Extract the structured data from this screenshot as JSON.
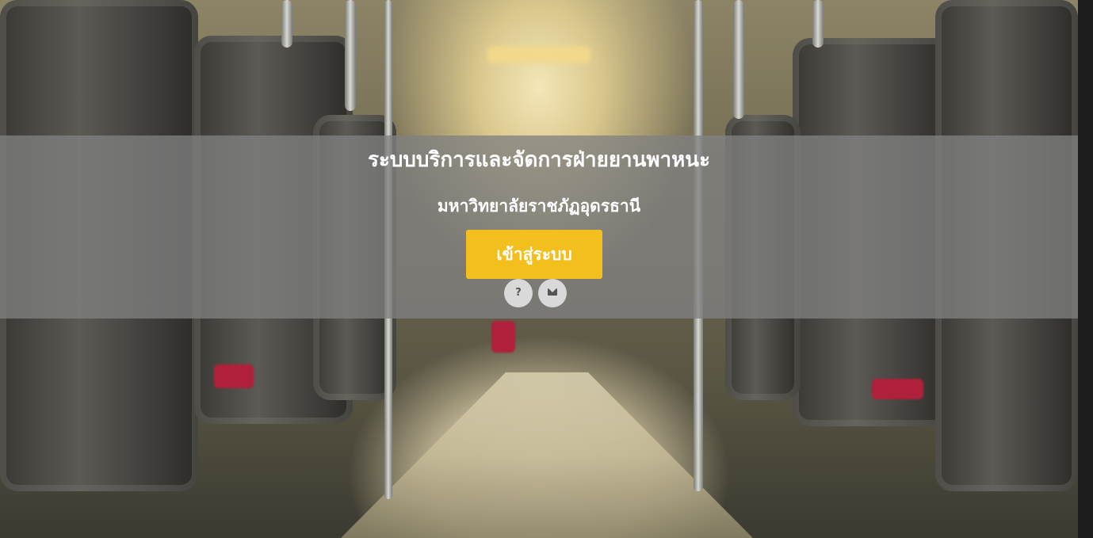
{
  "header": {
    "title": "ระบบบริการและจัดการฝ่ายยานพาหนะ",
    "subtitle": "มหาวิทยาลัยราชภัฏอุดรธานี"
  },
  "actions": {
    "login_label": "เข้าสู่ระบบ",
    "help_label": "?",
    "help_icon": "question-icon",
    "contact_icon": "envelope-icon"
  },
  "colors": {
    "accent": "#f3bf1c",
    "overlay": "#808080",
    "circle_button": "#d9d9d9"
  }
}
